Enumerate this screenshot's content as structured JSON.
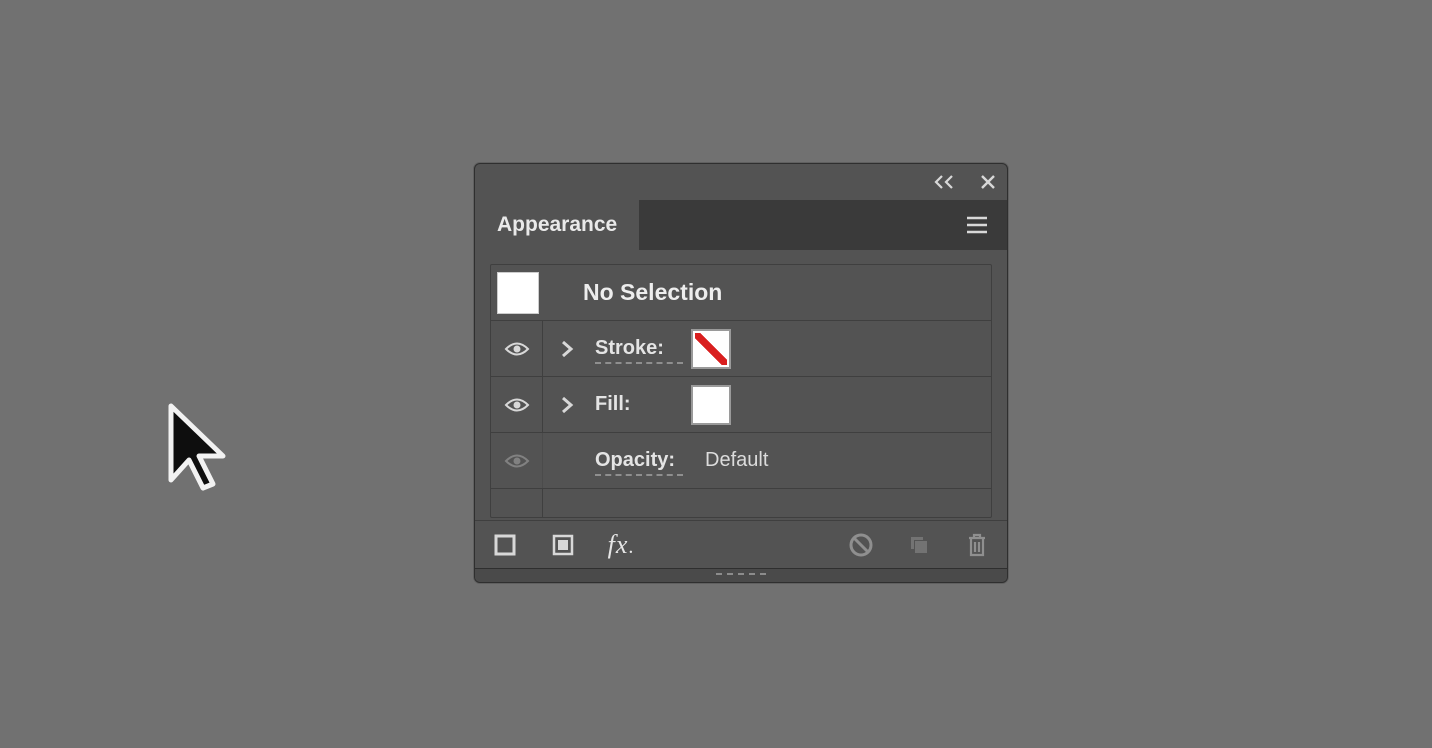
{
  "panel": {
    "title": "Appearance",
    "selection_thumb_color": "#ffffff",
    "selection_label": "No Selection",
    "rows": {
      "stroke": {
        "label": "Stroke:",
        "swatch": "none"
      },
      "fill": {
        "label": "Fill:",
        "swatch": "white"
      },
      "opacity": {
        "label": "Opacity:",
        "value": "Default"
      }
    }
  }
}
